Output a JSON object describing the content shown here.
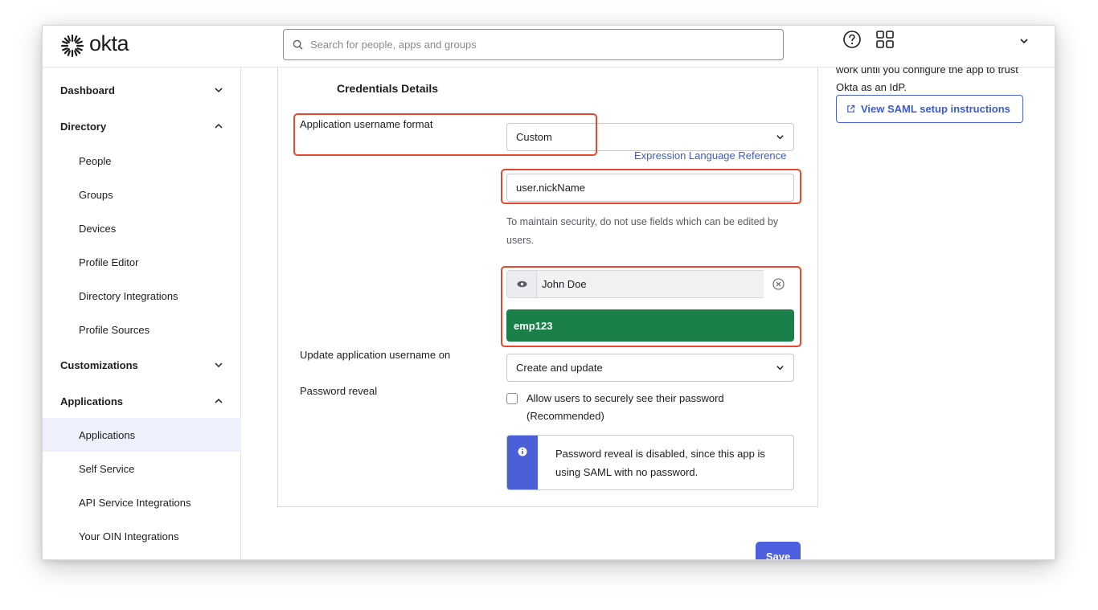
{
  "brand": {
    "name": "okta"
  },
  "search": {
    "placeholder": "Search for people, apps and groups",
    "value": ""
  },
  "sidebar": {
    "groups": [
      {
        "label": "Dashboard",
        "expanded": false
      },
      {
        "label": "Directory",
        "expanded": true
      },
      {
        "label": "Customizations",
        "expanded": false
      },
      {
        "label": "Applications",
        "expanded": true
      }
    ],
    "directory_items": [
      "People",
      "Groups",
      "Devices",
      "Profile Editor",
      "Directory Integrations",
      "Profile Sources"
    ],
    "applications_items": [
      "Applications",
      "Self Service",
      "API Service Integrations",
      "Your OIN Integrations"
    ],
    "active_item": "Applications"
  },
  "credentials": {
    "section_title": "Credentials Details",
    "username_format_label": "Application username format",
    "username_format_value": "Custom",
    "expression_link": "Expression Language Reference",
    "expression_value": "user.nickName",
    "security_hint": "To maintain security, do not use fields which can be edited by users.",
    "preview_user": "John Doe",
    "preview_result": "emp123",
    "update_label": "Update application username on",
    "update_value": "Create and update",
    "password_reveal_label": "Password reveal",
    "password_reveal_checkbox": "Allow users to securely see their password (Recommended)",
    "password_reveal_checked": false,
    "password_reveal_notice": "Password reveal is disabled, since this app is using SAML with no password."
  },
  "actions": {
    "save_label": "Save"
  },
  "right_panel": {
    "text_partial": "work until you configure the app to trust Okta as an IdP.",
    "saml_button": "View SAML setup instructions"
  },
  "colors": {
    "accent": "#4c5fdf",
    "link": "#3a5ad6",
    "success": "#1b7f4a",
    "highlight": "#e8472f",
    "info": "#4b5fd9"
  },
  "icons": [
    "okta-logo-icon",
    "search-icon",
    "help-icon",
    "apps-grid-icon",
    "chevron-down-icon",
    "chevron-up-icon",
    "eye-icon",
    "clear-icon",
    "info-icon",
    "external-link-icon"
  ]
}
